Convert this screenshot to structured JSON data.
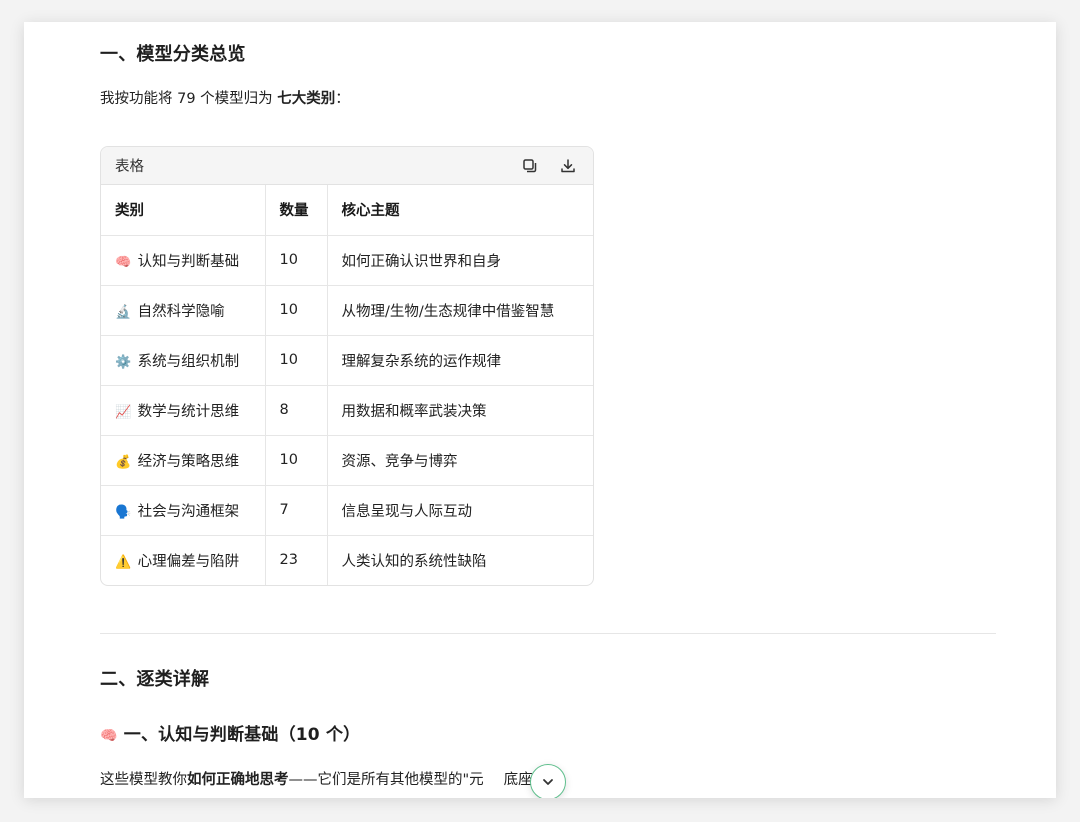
{
  "section1": {
    "title": "一、模型分类总览",
    "intro_pre": "我按功能将 79 个模型归为 ",
    "intro_bold": "七大类别",
    "intro_post": "："
  },
  "table": {
    "label": "表格",
    "headers": [
      "类别",
      "数量",
      "核心主题"
    ],
    "rows": [
      {
        "emoji": "🧠",
        "category": "认知与判断基础",
        "count": "10",
        "theme": "如何正确认识世界和自身"
      },
      {
        "emoji": "🔬",
        "category": "自然科学隐喻",
        "count": "10",
        "theme": "从物理/生物/生态规律中借鉴智慧"
      },
      {
        "emoji": "⚙️",
        "category": "系统与组织机制",
        "count": "10",
        "theme": "理解复杂系统的运作规律"
      },
      {
        "emoji": "📈",
        "category": "数学与统计思维",
        "count": "8",
        "theme": "用数据和概率武装决策"
      },
      {
        "emoji": "💰",
        "category": "经济与策略思维",
        "count": "10",
        "theme": "资源、竞争与博弈"
      },
      {
        "emoji": "🗣️",
        "category": "社会与沟通框架",
        "count": "7",
        "theme": "信息呈现与人际互动"
      },
      {
        "emoji": "⚠️",
        "category": "心理偏差与陷阱",
        "count": "23",
        "theme": "人类认知的系统性缺陷"
      }
    ]
  },
  "section2": {
    "title": "二、逐类详解",
    "sub_emoji": "🧠",
    "subtitle": "一、认知与判断基础（10 个）",
    "para_pre": "这些模型教你",
    "para_bold": "如何正确地思考",
    "para_post": "——它们是所有其他模型的\"元",
    "para_tail": "底座。"
  },
  "colors": {
    "accent": "#5fbf8d"
  }
}
